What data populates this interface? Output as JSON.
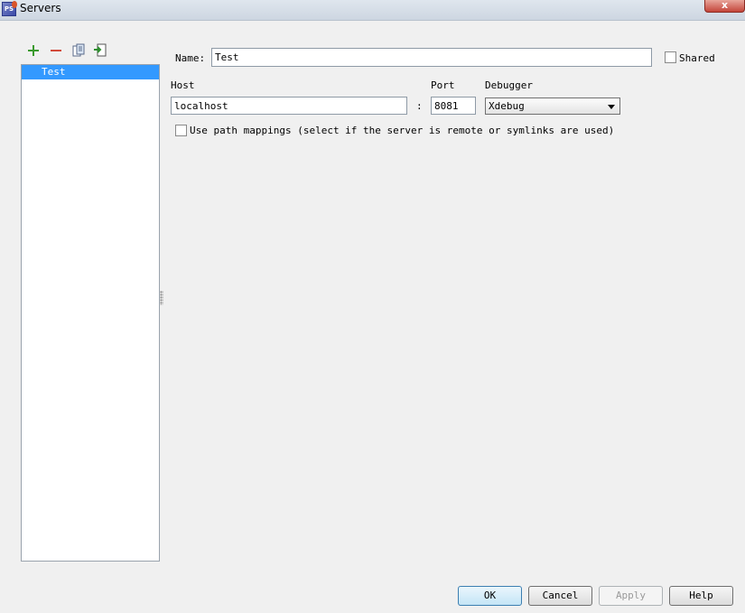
{
  "window": {
    "title": "Servers",
    "close_label": "x"
  },
  "toolbar": {
    "add_icon": "plus-icon",
    "remove_icon": "minus-icon",
    "copy_icon": "copy-icon",
    "import_icon": "import-icon"
  },
  "servers": [
    {
      "label": "Test",
      "selected": true
    }
  ],
  "form": {
    "name_label": "Name:",
    "name_value": "Test",
    "shared_label": "Shared",
    "host_label": "Host",
    "host_value": "localhost",
    "colon": ":",
    "port_label": "Port",
    "port_value": "8081",
    "debugger_label": "Debugger",
    "debugger_value": "Xdebug",
    "path_mappings_label": "Use path mappings (select if the server is remote or symlinks are used)"
  },
  "buttons": {
    "ok": "OK",
    "cancel": "Cancel",
    "apply": "Apply",
    "help": "Help"
  },
  "colors": {
    "selection": "#3399ff",
    "add": "#3a9a2e",
    "remove": "#d24a3a"
  }
}
